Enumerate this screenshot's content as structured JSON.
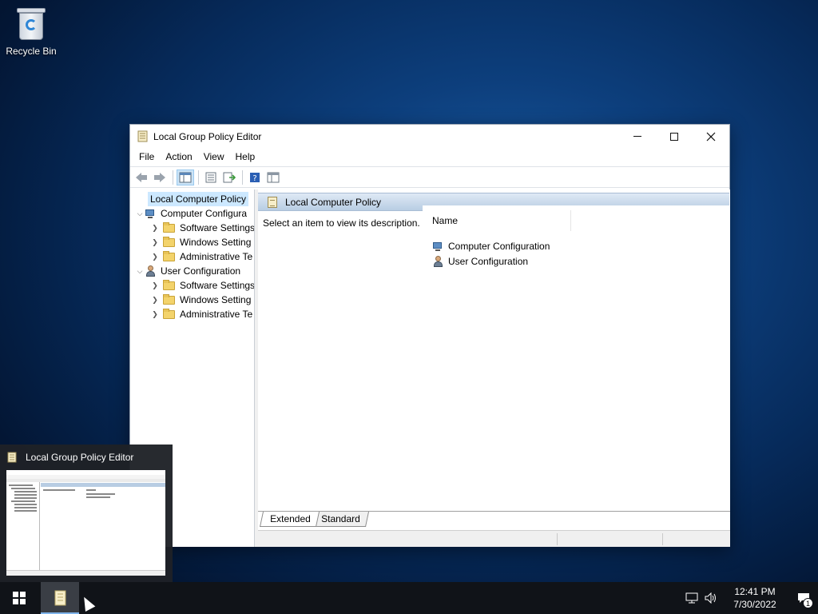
{
  "desktop": {
    "recycle_bin_label": "Recycle Bin",
    "icons": {
      "recycle_bin": "recycle-bin-icon"
    }
  },
  "window": {
    "title": "Local Group Policy Editor",
    "menu": [
      "File",
      "Action",
      "View",
      "Help"
    ],
    "tree": {
      "root": "Local Computer Policy",
      "computer_config": "Computer Configura",
      "user_config": "User Configuration",
      "computer_children": [
        "Software Settings",
        "Windows Setting",
        "Administrative Te"
      ],
      "user_children": [
        "Software Settings",
        "Windows Setting",
        "Administrative Te"
      ]
    },
    "right_pane": {
      "header": "Local Computer Policy",
      "description": "Select an item to view its description.",
      "column_name": "Name",
      "items": [
        "Computer Configuration",
        "User Configuration"
      ]
    },
    "tabs": [
      "Extended",
      "Standard"
    ],
    "accent_color": "#cce8ff",
    "header_color": "#b8cde3"
  },
  "thumbnail": {
    "title": "Local Group Policy Editor"
  },
  "taskbar": {
    "time": "12:41 PM",
    "date": "7/30/2022",
    "notification_count": "1"
  }
}
